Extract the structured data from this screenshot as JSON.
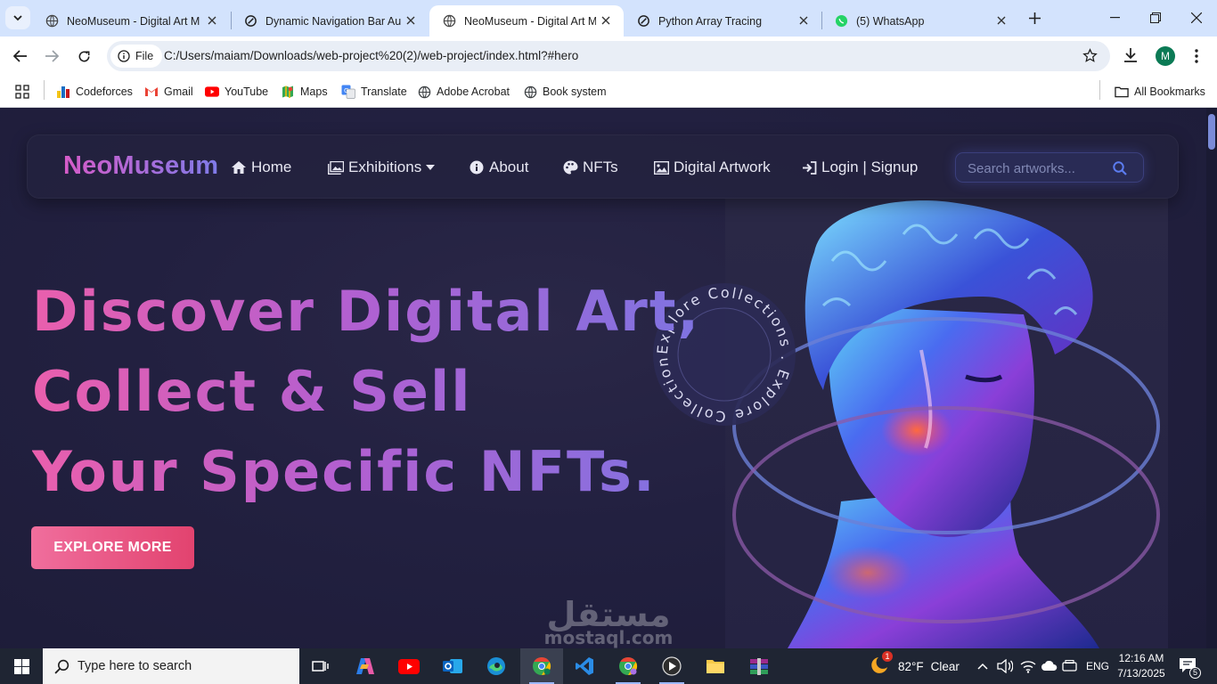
{
  "browser": {
    "tabs": [
      {
        "title": "NeoMuseum - Digital Art M",
        "icon": "globe-icon",
        "active": false
      },
      {
        "title": "Dynamic Navigation Bar Aut",
        "icon": "openai-icon",
        "active": false
      },
      {
        "title": "NeoMuseum - Digital Art M",
        "icon": "globe-icon",
        "active": true
      },
      {
        "title": "Python Array Tracing",
        "icon": "openai-icon",
        "active": false
      },
      {
        "title": "(5) WhatsApp",
        "icon": "whatsapp-icon",
        "active": false
      }
    ],
    "address": {
      "scheme_label": "File",
      "url": "C:/Users/maiam/Downloads/web-project%20(2)/web-project/index.html?#hero"
    },
    "profile_initial": "M",
    "bookmarks": [
      {
        "label": "Codeforces",
        "icon": "codeforces-icon"
      },
      {
        "label": "Gmail",
        "icon": "gmail-icon"
      },
      {
        "label": "YouTube",
        "icon": "youtube-icon"
      },
      {
        "label": "Maps",
        "icon": "maps-icon"
      },
      {
        "label": "Translate",
        "icon": "translate-icon"
      },
      {
        "label": "Adobe Acrobat",
        "icon": "globe-icon"
      },
      {
        "label": "Book system",
        "icon": "globe-icon"
      }
    ],
    "all_bookmarks": "All Bookmarks"
  },
  "site": {
    "logo": "NeoMuseum",
    "nav": [
      {
        "label": "Home",
        "icon": "home-icon"
      },
      {
        "label": "Exhibitions",
        "icon": "images-icon",
        "dropdown": true
      },
      {
        "label": "About",
        "icon": "info-icon"
      },
      {
        "label": "NFTs",
        "icon": "palette-icon"
      },
      {
        "label": "Digital Artwork",
        "icon": "image-icon"
      },
      {
        "label": "Login | Signup",
        "icon": "login-icon"
      }
    ],
    "search_placeholder": "Search artworks...",
    "hero": {
      "lines": [
        "Discover Digital Art,",
        "Collect & Sell",
        "Your Specific NFTs."
      ],
      "cta": "EXPLORE MORE",
      "badge_text": "Explore Collections . Explore Collections . "
    },
    "watermark": {
      "arabic": "مستقل",
      "latin": "mostaql.com"
    }
  },
  "taskbar": {
    "search_placeholder": "Type here to search",
    "weather": {
      "temp": "82°F",
      "condition": "Clear",
      "alert_count": "1"
    },
    "language": "ENG",
    "time": "12:16 AM",
    "date": "7/13/2025",
    "notifications": "5"
  },
  "colors": {
    "accent_pink": "#ea5fad",
    "accent_purple": "#7d74e2",
    "page_bg": "#1e1d3a",
    "cta_pink": "#e2436f"
  }
}
